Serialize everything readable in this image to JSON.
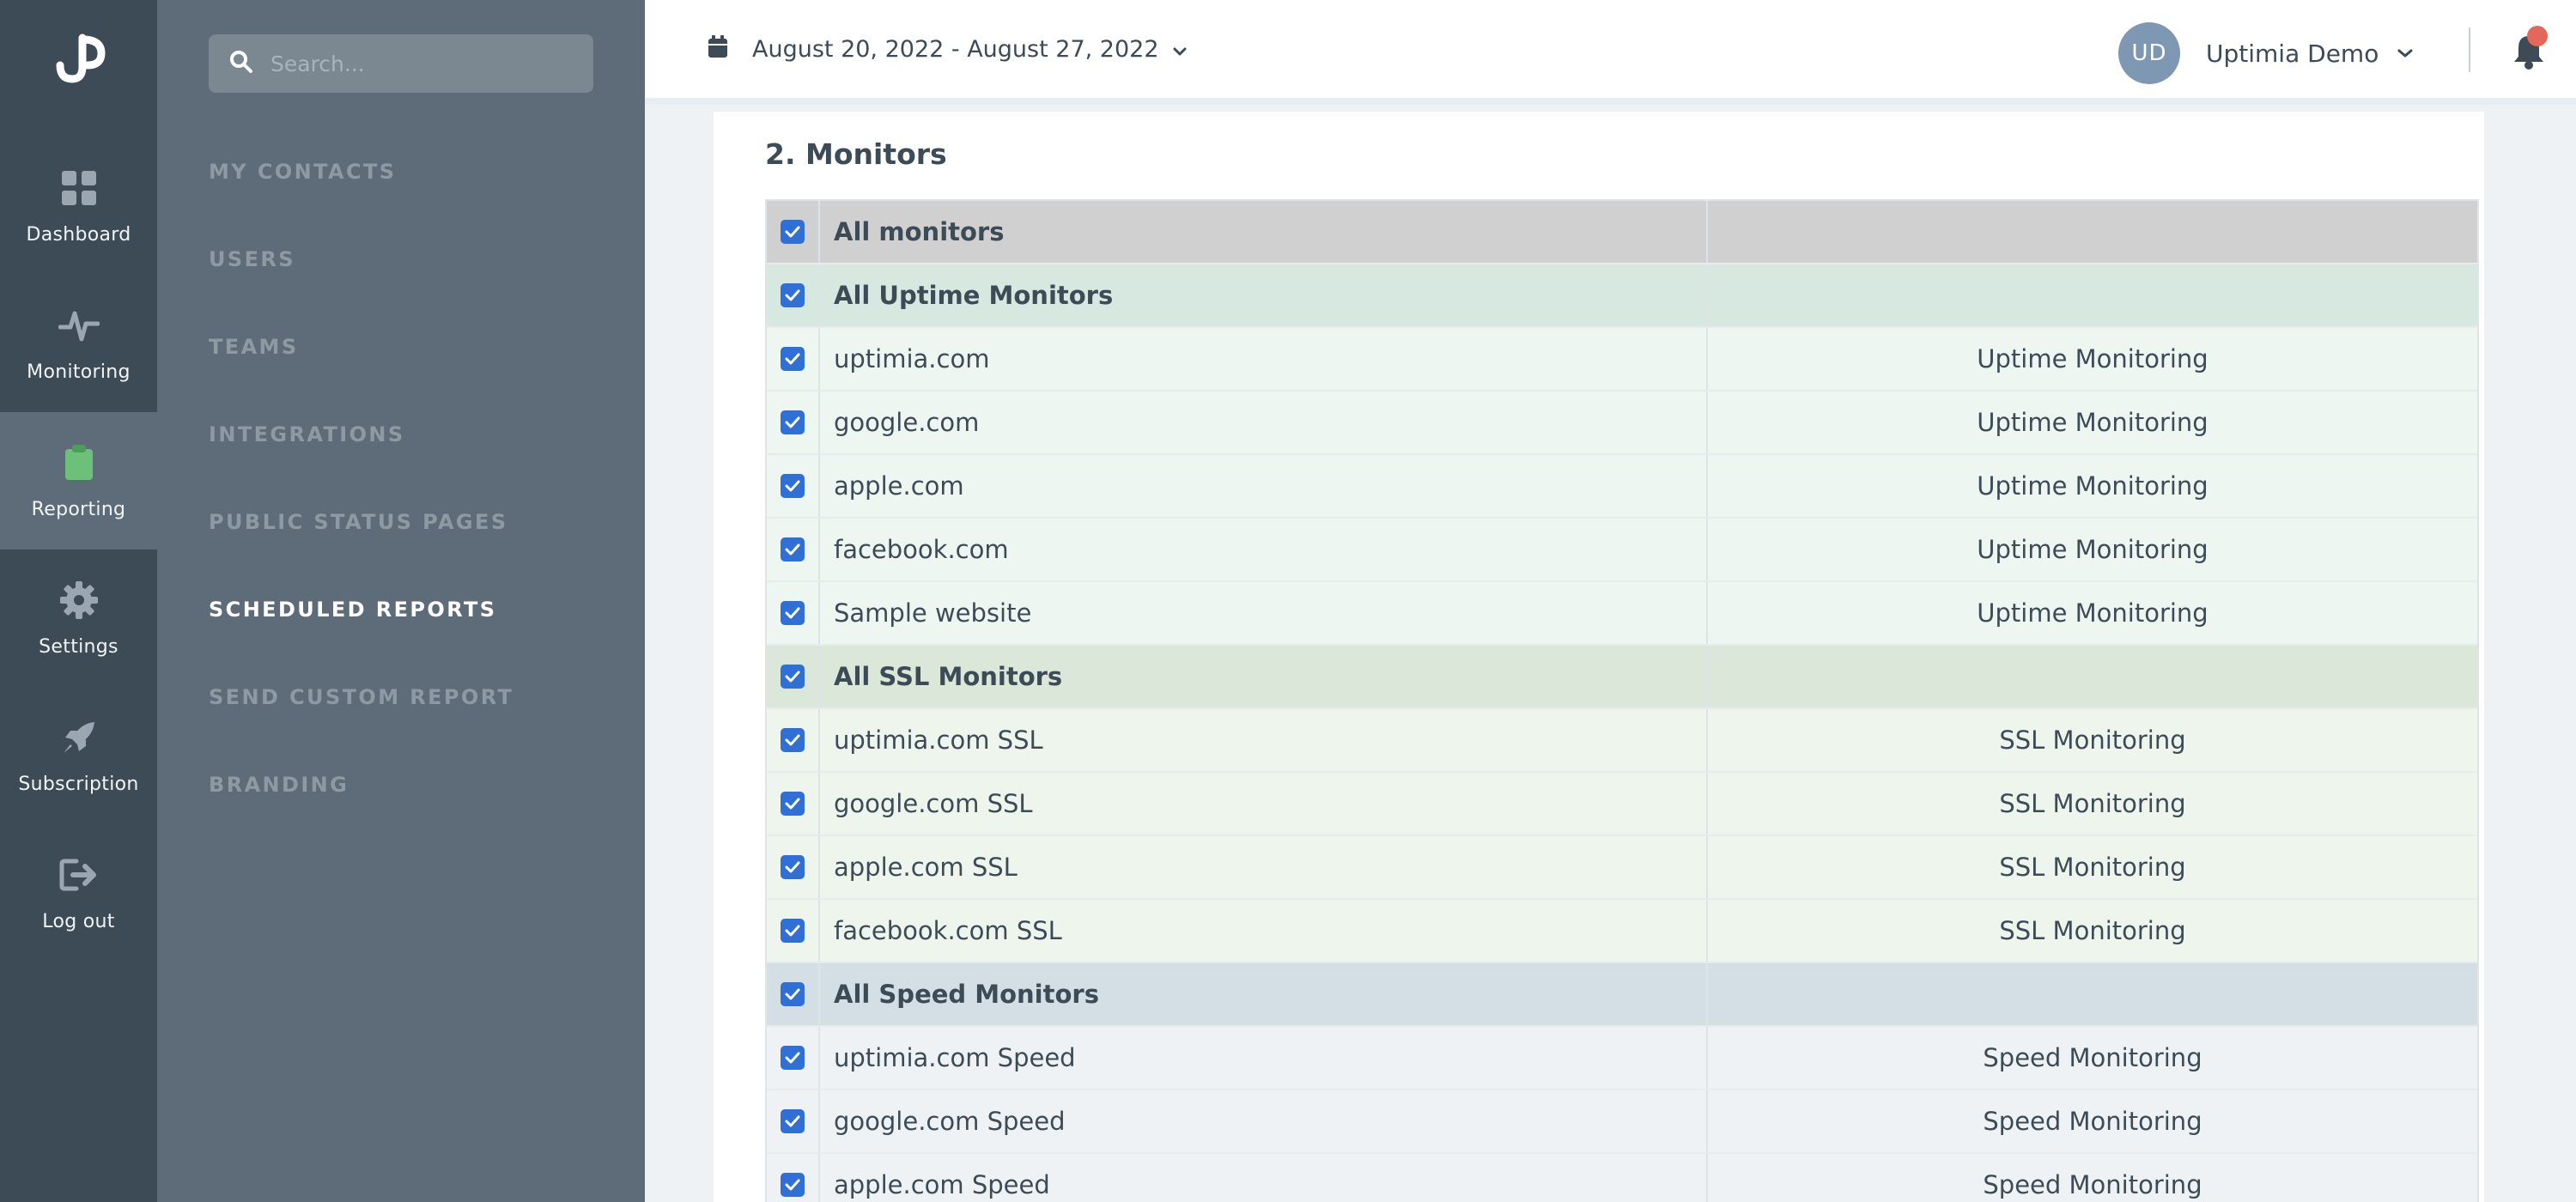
{
  "rail": {
    "items": [
      {
        "label": "Dashboard",
        "icon": "dashboard-icon"
      },
      {
        "label": "Monitoring",
        "icon": "pulse-icon"
      },
      {
        "label": "Reporting",
        "icon": "clipboard-icon"
      },
      {
        "label": "Settings",
        "icon": "gear-icon"
      },
      {
        "label": "Subscription",
        "icon": "rocket-icon"
      },
      {
        "label": "Log out",
        "icon": "logout-icon"
      }
    ],
    "active": "Reporting",
    "accent_color": "#6cc07a"
  },
  "sidebar": {
    "search_placeholder": "Search...",
    "links": [
      "MY CONTACTS",
      "USERS",
      "TEAMS",
      "INTEGRATIONS",
      "PUBLIC STATUS PAGES",
      "SCHEDULED REPORTS",
      "SEND CUSTOM REPORT",
      "BRANDING"
    ],
    "active": "SCHEDULED REPORTS"
  },
  "topbar": {
    "date_range": "August 20, 2022 - August 27, 2022",
    "user_initials": "UD",
    "user_name": "Uptimia Demo",
    "notification_color": "#e3685a"
  },
  "section": {
    "title": "2. Monitors"
  },
  "monitors": {
    "rows": [
      {
        "name": "All monitors",
        "type": "",
        "kind": "header-all",
        "checked": true
      },
      {
        "name": "All Uptime Monitors",
        "type": "",
        "kind": "header-uptime",
        "checked": true
      },
      {
        "name": "uptimia.com",
        "type": "Uptime Monitoring",
        "kind": "uptime",
        "checked": true
      },
      {
        "name": "google.com",
        "type": "Uptime Monitoring",
        "kind": "uptime",
        "checked": true
      },
      {
        "name": "apple.com",
        "type": "Uptime Monitoring",
        "kind": "uptime",
        "checked": true
      },
      {
        "name": "facebook.com",
        "type": "Uptime Monitoring",
        "kind": "uptime",
        "checked": true
      },
      {
        "name": "Sample website",
        "type": "Uptime Monitoring",
        "kind": "uptime",
        "checked": true
      },
      {
        "name": "All SSL Monitors",
        "type": "",
        "kind": "header-ssl",
        "checked": true
      },
      {
        "name": "uptimia.com SSL",
        "type": "SSL Monitoring",
        "kind": "ssl",
        "checked": true
      },
      {
        "name": "google.com SSL",
        "type": "SSL Monitoring",
        "kind": "ssl",
        "checked": true
      },
      {
        "name": "apple.com SSL",
        "type": "SSL Monitoring",
        "kind": "ssl",
        "checked": true
      },
      {
        "name": "facebook.com SSL",
        "type": "SSL Monitoring",
        "kind": "ssl",
        "checked": true
      },
      {
        "name": "All Speed Monitors",
        "type": "",
        "kind": "header-speed",
        "checked": true
      },
      {
        "name": "uptimia.com Speed",
        "type": "Speed Monitoring",
        "kind": "speed",
        "checked": true
      },
      {
        "name": "google.com Speed",
        "type": "Speed Monitoring",
        "kind": "speed",
        "checked": true
      },
      {
        "name": "apple.com Speed",
        "type": "Speed Monitoring",
        "kind": "speed",
        "checked": true
      }
    ]
  }
}
